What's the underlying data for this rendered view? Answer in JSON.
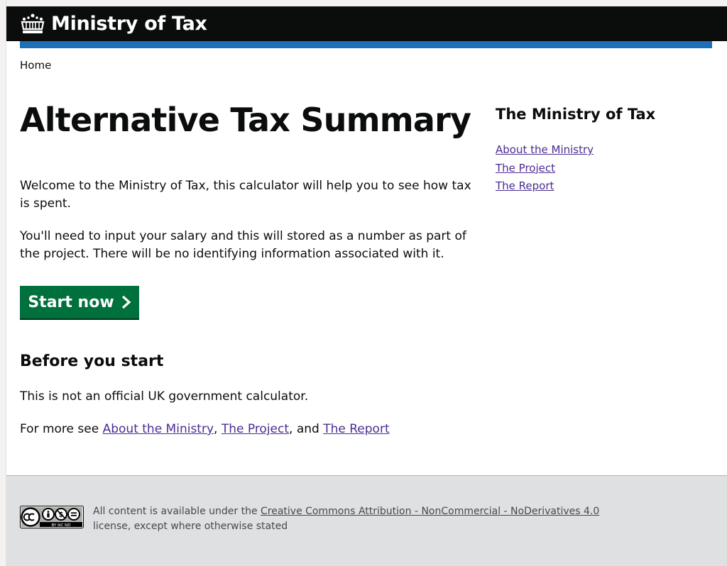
{
  "header": {
    "logo_text": "Ministry of Tax"
  },
  "breadcrumb": {
    "home": "Home"
  },
  "main": {
    "title": "Alternative Tax Summary",
    "intro_1": "Welcome to the Ministry of Tax, this calculator will help you to see how tax is spent.",
    "intro_2": "You'll need to input your salary and this will stored as a number as part of the project. There will be no identifying information associated with it.",
    "start_button": "Start now",
    "before_heading": "Before you start",
    "disclaimer": "This is not an official UK government calculator.",
    "more_prefix": "For more see ",
    "more_link_1": "About the Ministry",
    "more_sep_1": ", ",
    "more_link_2": "The Project",
    "more_sep_2": ", and ",
    "more_link_3": "The Report"
  },
  "sidebar": {
    "title": "The Ministry of Tax",
    "links": [
      "About the Ministry",
      "The Project",
      "The Report"
    ]
  },
  "footer": {
    "license_prefix": "All content is available under the ",
    "license_link": "Creative Commons Attribution - NonCommercial - NoDerivatives 4.0",
    "license_suffix": " license, except where otherwise stated",
    "badge_text": "BY NC ND"
  },
  "colors": {
    "header_bg": "#0b0c0c",
    "accent_blue": "#1d70b8",
    "button_green": "#00703c",
    "link": "#4c2c92",
    "footer_bg": "#dee0e2"
  },
  "icons": [
    "crown-icon",
    "chevron-right-icon",
    "creative-commons-icon"
  ]
}
